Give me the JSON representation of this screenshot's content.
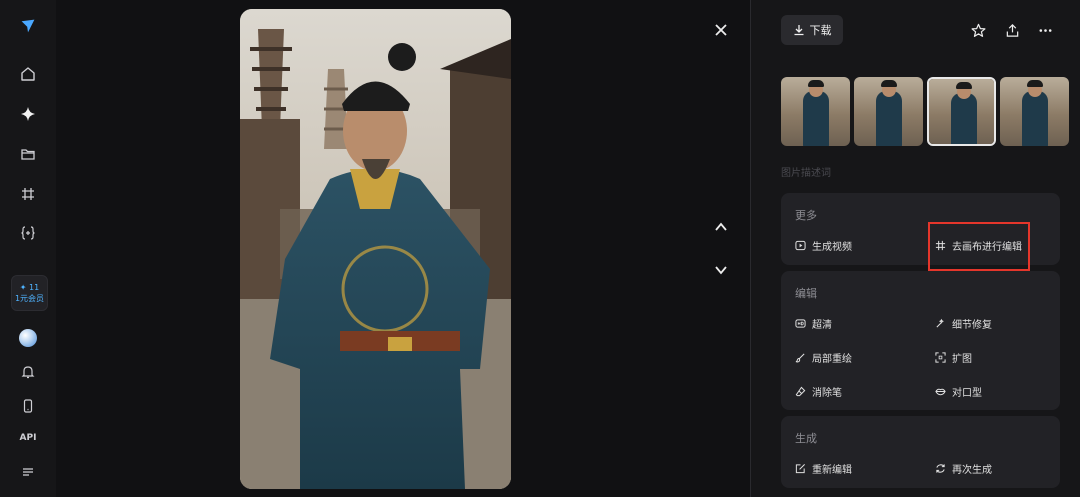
{
  "sidebar": {
    "items": [
      {
        "name": "home-icon"
      },
      {
        "name": "sparkle-icon"
      },
      {
        "name": "folder-icon"
      },
      {
        "name": "canvas-icon"
      },
      {
        "name": "braces-icon"
      }
    ],
    "member": {
      "count": "✦ 11",
      "label": "1元会员"
    },
    "api_label": "API"
  },
  "viewer": {
    "image_alt": "Portrait of a man in Ming dynasty official robe standing in a busy ancient street with pagodas"
  },
  "panel": {
    "download_label": "下载",
    "description_placeholder": "图片描述词",
    "more": {
      "title": "更多",
      "generate_video": "生成视频",
      "edit_on_canvas": "去画布进行编辑"
    },
    "edit": {
      "title": "编辑",
      "hd": "超清",
      "detail_repair": "细节修复",
      "inpaint": "局部重绘",
      "expand": "扩图",
      "eraser": "消除笔",
      "lip_sync": "对口型"
    },
    "generate": {
      "title": "生成",
      "re_edit": "重新编辑",
      "regenerate": "再次生成"
    }
  },
  "colors": {
    "accent_highlight": "#e5362b",
    "member_text": "#4fb3ff",
    "panel_bg": "#161618",
    "card_bg": "#222226"
  }
}
